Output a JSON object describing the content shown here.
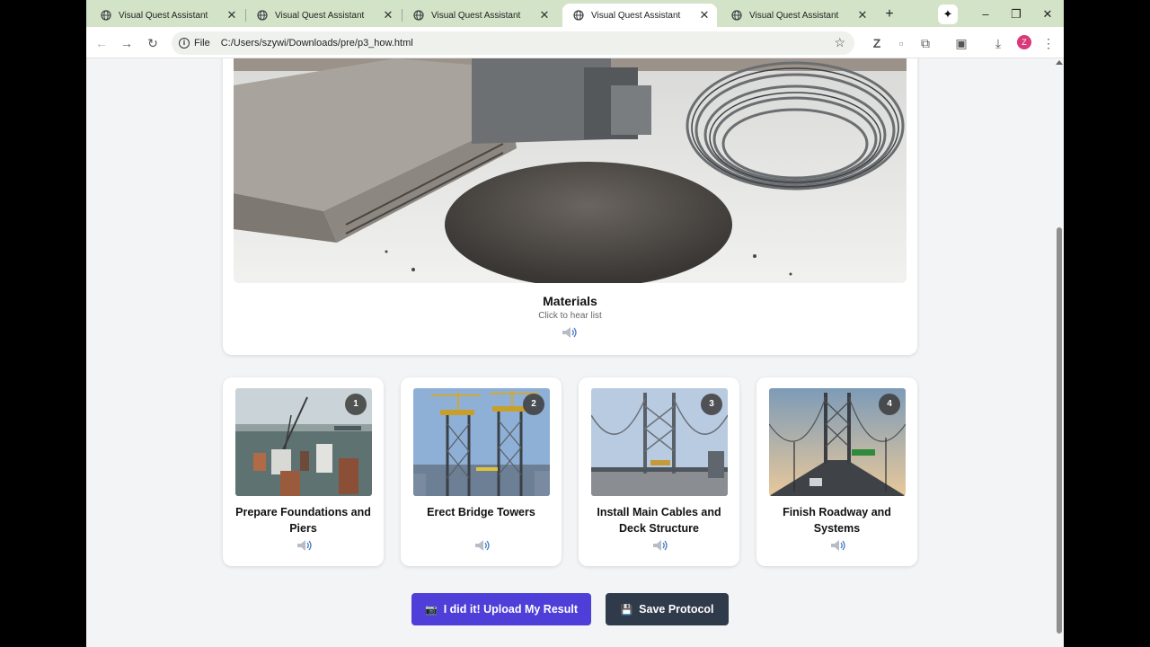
{
  "browser": {
    "tabs": [
      {
        "title": "Visual Quest Assistant",
        "active": false
      },
      {
        "title": "Visual Quest Assistant",
        "active": false
      },
      {
        "title": "Visual Quest Assistant",
        "active": false
      },
      {
        "title": "Visual Quest Assistant",
        "active": true
      },
      {
        "title": "Visual Quest Assistant",
        "active": false
      }
    ],
    "address": {
      "scheme": "File",
      "url": "C:/Users/szywi/Downloads/pre/p3_how.html"
    },
    "profile_initial": "Z"
  },
  "materials": {
    "title": "Materials",
    "subtitle": "Click to hear list"
  },
  "steps": [
    {
      "number": "1",
      "title": "Prepare Foundations and Piers"
    },
    {
      "number": "2",
      "title": "Erect Bridge Towers"
    },
    {
      "number": "3",
      "title": "Install Main Cables and Deck Structure"
    },
    {
      "number": "4",
      "title": "Finish Roadway and Systems"
    }
  ],
  "actions": {
    "upload_label": "I did it! Upload My Result",
    "save_label": "Save Protocol"
  },
  "colors": {
    "tab_strip": "#d3e3c8",
    "upload_button": "#4f3ed8",
    "save_button": "#2f3a4a"
  }
}
